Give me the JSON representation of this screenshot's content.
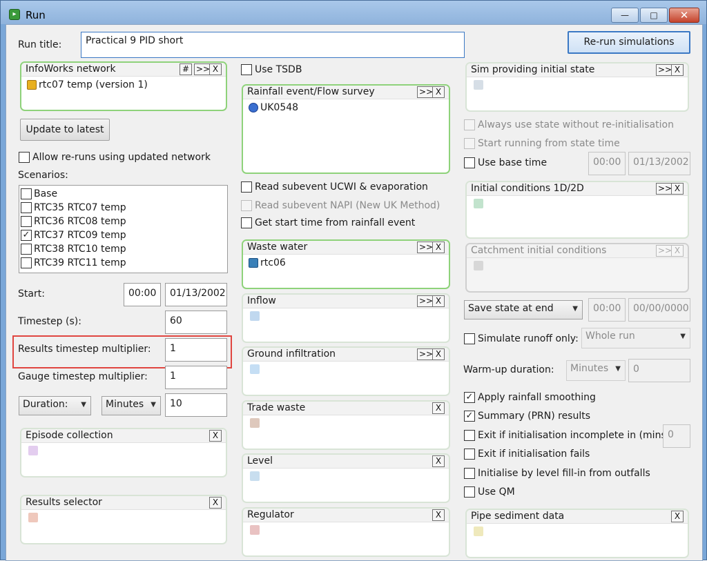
{
  "window": {
    "title": "Run",
    "app_icon": "run-icon",
    "controls": {
      "minimize": "—",
      "maximize": "□",
      "close": "✕"
    }
  },
  "run_title": {
    "label": "Run title:",
    "value": "Practical 9 PID short"
  },
  "rerun_button": "Re-run simulations",
  "network": {
    "title": "InfoWorks network",
    "btn_hash": "#",
    "btn_more": ">>",
    "btn_x": "X",
    "item": "rtc07 temp (version 1)",
    "icon": "network-icon"
  },
  "update_button": "Update to latest",
  "allow_reruns": {
    "label": "Allow re-runs using updated network",
    "checked": false
  },
  "scenarios": {
    "label": "Scenarios:",
    "items": [
      {
        "label": "Base",
        "mark": ""
      },
      {
        "label": "RTC35 RTC07 temp",
        "mark": ""
      },
      {
        "label": "RTC36 RTC08 temp",
        "mark": ""
      },
      {
        "label": "RTC37 RTC09 temp",
        "mark": "✓"
      },
      {
        "label": "RTC38 RTC10 temp",
        "mark": ""
      },
      {
        "label": "RTC39 RTC11 temp",
        "mark": ""
      }
    ]
  },
  "start": {
    "label": "Start:",
    "time": "00:00",
    "date": "01/13/2002"
  },
  "timestep": {
    "label": "Timestep (s):",
    "value": "60"
  },
  "results_multiplier": {
    "label": "Results timestep multiplier:",
    "value": "1"
  },
  "gauge_multiplier": {
    "label": "Gauge timestep multiplier:",
    "value": "1"
  },
  "duration": {
    "type": "Duration:",
    "unit": "Minutes",
    "value": "10"
  },
  "episode": {
    "title": "Episode collection",
    "btn_x": "X"
  },
  "results_selector": {
    "title": "Results selector",
    "btn_x": "X"
  },
  "use_tsdb": {
    "label": "Use TSDB",
    "checked": false
  },
  "rainfall": {
    "title": "Rainfall event/Flow survey",
    "btn_more": ">>",
    "btn_x": "X",
    "item": "UK0548"
  },
  "read_ucwi": {
    "label": "Read subevent UCWI & evaporation",
    "checked": false
  },
  "read_napi": {
    "label": "Read subevent NAPI (New UK Method)",
    "checked": false
  },
  "get_start": {
    "label": "Get start time from rainfall event",
    "checked": false
  },
  "waste_water": {
    "title": "Waste water",
    "btn_more": ">>",
    "btn_x": "X",
    "item": "rtc06"
  },
  "inflow": {
    "title": "Inflow",
    "btn_more": ">>",
    "btn_x": "X"
  },
  "ground_infiltration": {
    "title": "Ground infiltration",
    "btn_more": ">>",
    "btn_x": "X"
  },
  "trade_waste": {
    "title": "Trade waste",
    "btn_x": "X"
  },
  "level": {
    "title": "Level",
    "btn_x": "X"
  },
  "regulator": {
    "title": "Regulator",
    "btn_x": "X"
  },
  "sim_state": {
    "title": "Sim providing initial state",
    "btn_more": ">>",
    "btn_x": "X"
  },
  "always_use_state": {
    "label": "Always use state without re-initialisation"
  },
  "start_from_state": {
    "label": "Start running from state time"
  },
  "use_base_time": {
    "label": "Use base time",
    "time": "00:00",
    "date": "01/13/2002"
  },
  "initial_1d2d": {
    "title": "Initial conditions 1D/2D",
    "btn_more": ">>",
    "btn_x": "X"
  },
  "catchment_initial": {
    "title": "Catchment initial conditions",
    "btn_more": ">>",
    "btn_x": "X"
  },
  "save_state": {
    "option": "Save state at end",
    "time": "00:00",
    "date": "00/00/0000"
  },
  "simulate_runoff": {
    "label": "Simulate runoff only:",
    "option": "Whole run"
  },
  "warmup": {
    "label": "Warm-up duration:",
    "unit": "Minutes",
    "value": "0"
  },
  "options": [
    {
      "label": "Apply rainfall smoothing",
      "mark": "✓"
    },
    {
      "label": "Summary (PRN) results",
      "mark": "✓"
    },
    {
      "label": "Exit if initialisation incomplete in (mins):",
      "mark": ""
    },
    {
      "label": "Exit if initialisation fails",
      "mark": ""
    },
    {
      "label": "Initialise by level fill-in from outfalls",
      "mark": ""
    },
    {
      "label": "Use QM",
      "mark": ""
    }
  ],
  "exit_incomplete_value": "0",
  "pipe_sediment": {
    "title": "Pipe sediment data",
    "btn_x": "X"
  }
}
